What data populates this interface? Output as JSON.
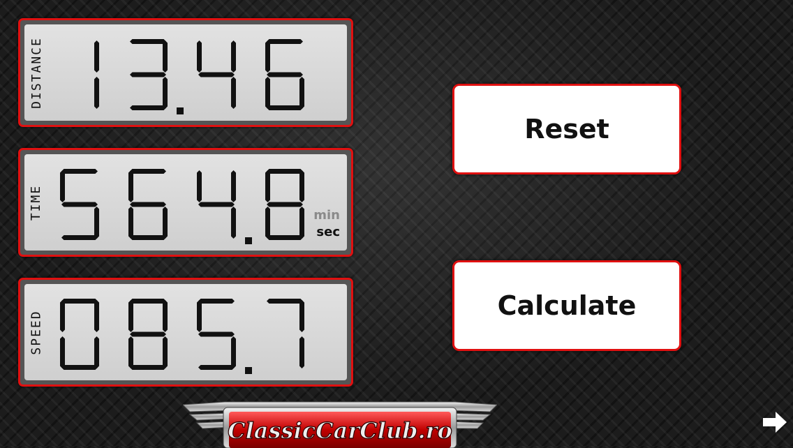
{
  "panels": [
    {
      "id": "distance",
      "label": "DISTANCE",
      "digits": "13.46"
    },
    {
      "id": "time",
      "label": "TIME",
      "digits": "564.8",
      "units": {
        "top": "min",
        "bottom": "sec"
      }
    },
    {
      "id": "speed",
      "label": "SPEED",
      "digits": "085.7"
    }
  ],
  "buttons": {
    "reset": "Reset",
    "calculate": "Calculate"
  },
  "logo": {
    "text": "ClassicCarClub.ro"
  },
  "icons": {
    "next": "right-arrow-icon"
  },
  "colors": {
    "accent": "#e01010",
    "lcd_bg": "#d9d9d9",
    "segment": "#111111"
  }
}
